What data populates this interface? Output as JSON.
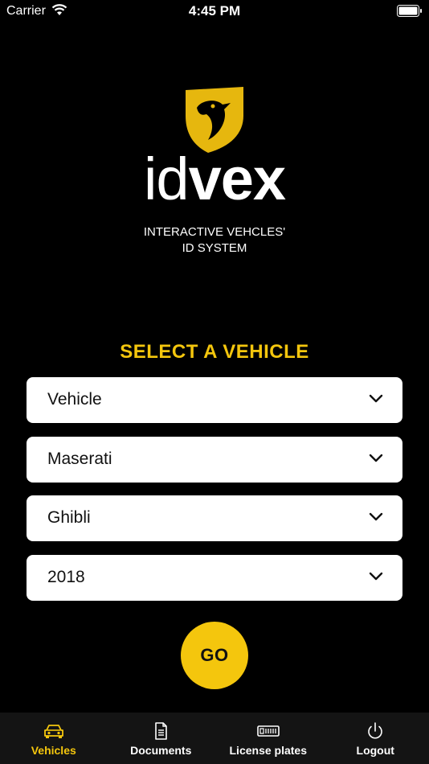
{
  "status_bar": {
    "carrier": "Carrier",
    "time": "4:45 PM"
  },
  "logo": {
    "word_light": "id",
    "word_bold": "vex",
    "tagline_line1": "INTERACTIVE VEHCLES'",
    "tagline_line2": "ID SYSTEM",
    "accent": "#f4c60d"
  },
  "form": {
    "title": "SELECT A VEHICLE",
    "selects": [
      {
        "value": "Vehicle"
      },
      {
        "value": "Maserati"
      },
      {
        "value": "Ghibli"
      },
      {
        "value": "2018"
      }
    ],
    "go_label": "GO"
  },
  "tab_bar": {
    "items": [
      {
        "label": "Vehicles",
        "icon": "car-icon",
        "active": true
      },
      {
        "label": "Documents",
        "icon": "document-icon",
        "active": false
      },
      {
        "label": "License plates",
        "icon": "license-plate-icon",
        "active": false
      },
      {
        "label": "Logout",
        "icon": "power-icon",
        "active": false
      }
    ]
  }
}
